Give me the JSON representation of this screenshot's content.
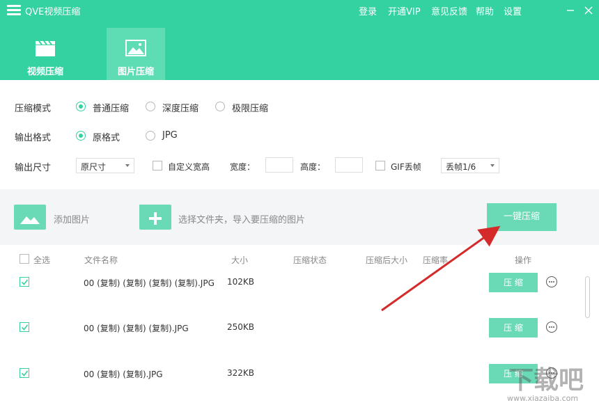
{
  "app": {
    "title": "QVE视频压缩"
  },
  "menu": {
    "login": "登录",
    "vip": "开通VIP",
    "feedback": "意见反馈",
    "help": "帮助",
    "settings": "设置"
  },
  "tabs": [
    {
      "label": "视频压缩",
      "icon": "clapperboard-icon",
      "active": false
    },
    {
      "label": "图片压缩",
      "icon": "image-icon",
      "active": true
    }
  ],
  "settings": {
    "mode": {
      "label": "压缩模式",
      "options": [
        "普通压缩",
        "深度压缩",
        "极限压缩"
      ],
      "selected": "普通压缩"
    },
    "format": {
      "label": "输出格式",
      "options": [
        "原格式",
        "JPG"
      ],
      "selected": "原格式"
    },
    "size": {
      "label": "输出尺寸",
      "select_value": "原尺寸",
      "custom_label": "自定义宽高",
      "width_label": "宽度：",
      "width_value": "",
      "height_label": "高度：",
      "height_value": "",
      "gif_label": "GIF丢帧",
      "gif_select_value": "丢帧1/6"
    }
  },
  "toolbar": {
    "add_image": "添加图片",
    "add_folder": "选择文件夹，导入要压缩的图片",
    "compress_all": "一键压缩"
  },
  "table": {
    "headers": {
      "select_all": "全选",
      "name": "文件名称",
      "size": "大小",
      "status": "压缩状态",
      "after_size": "压缩后大小",
      "ratio": "压缩率",
      "action": "操作"
    },
    "rows": [
      {
        "checked": true,
        "name": "00 (复制) (复制) (复制) (复制).JPG",
        "size": "102KB",
        "button": "压 缩"
      },
      {
        "checked": true,
        "name": "00 (复制) (复制) (复制).JPG",
        "size": "250KB",
        "button": "压 缩"
      },
      {
        "checked": true,
        "name": "00 (复制) (复制).JPG",
        "size": "322KB",
        "button": "压 缩"
      }
    ]
  },
  "watermark": {
    "text": "下载吧",
    "url": "www.xiazaiba.com"
  },
  "colors": {
    "accent": "#35d2a1",
    "accent_light": "#6ad9b5",
    "arrow": "#d42a2a"
  }
}
